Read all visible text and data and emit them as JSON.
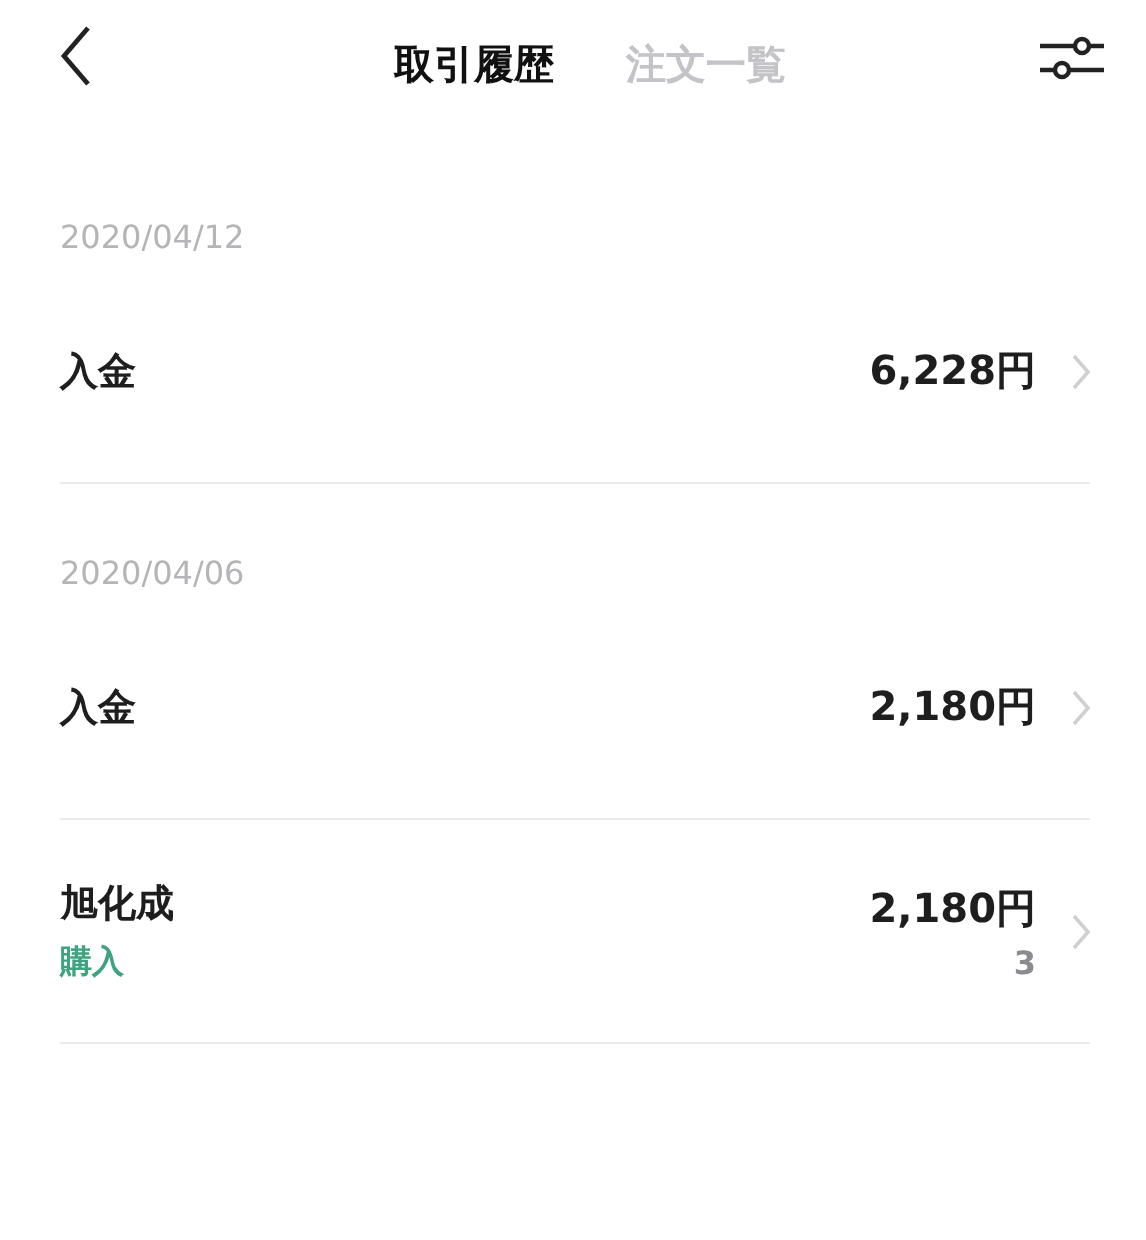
{
  "header": {
    "tabs": [
      {
        "label": "取引履歴",
        "selected": true
      },
      {
        "label": "注文一覧",
        "selected": false
      }
    ]
  },
  "groups": [
    {
      "date": "2020/04/12",
      "rows": [
        {
          "title": "入金",
          "amount": "6,228円"
        }
      ]
    },
    {
      "date": "2020/04/06",
      "rows": [
        {
          "title": "入金",
          "amount": "2,180円"
        },
        {
          "title": "旭化成",
          "subtitle": "購入",
          "amount": "2,180円",
          "quantity": "3"
        }
      ]
    }
  ]
}
